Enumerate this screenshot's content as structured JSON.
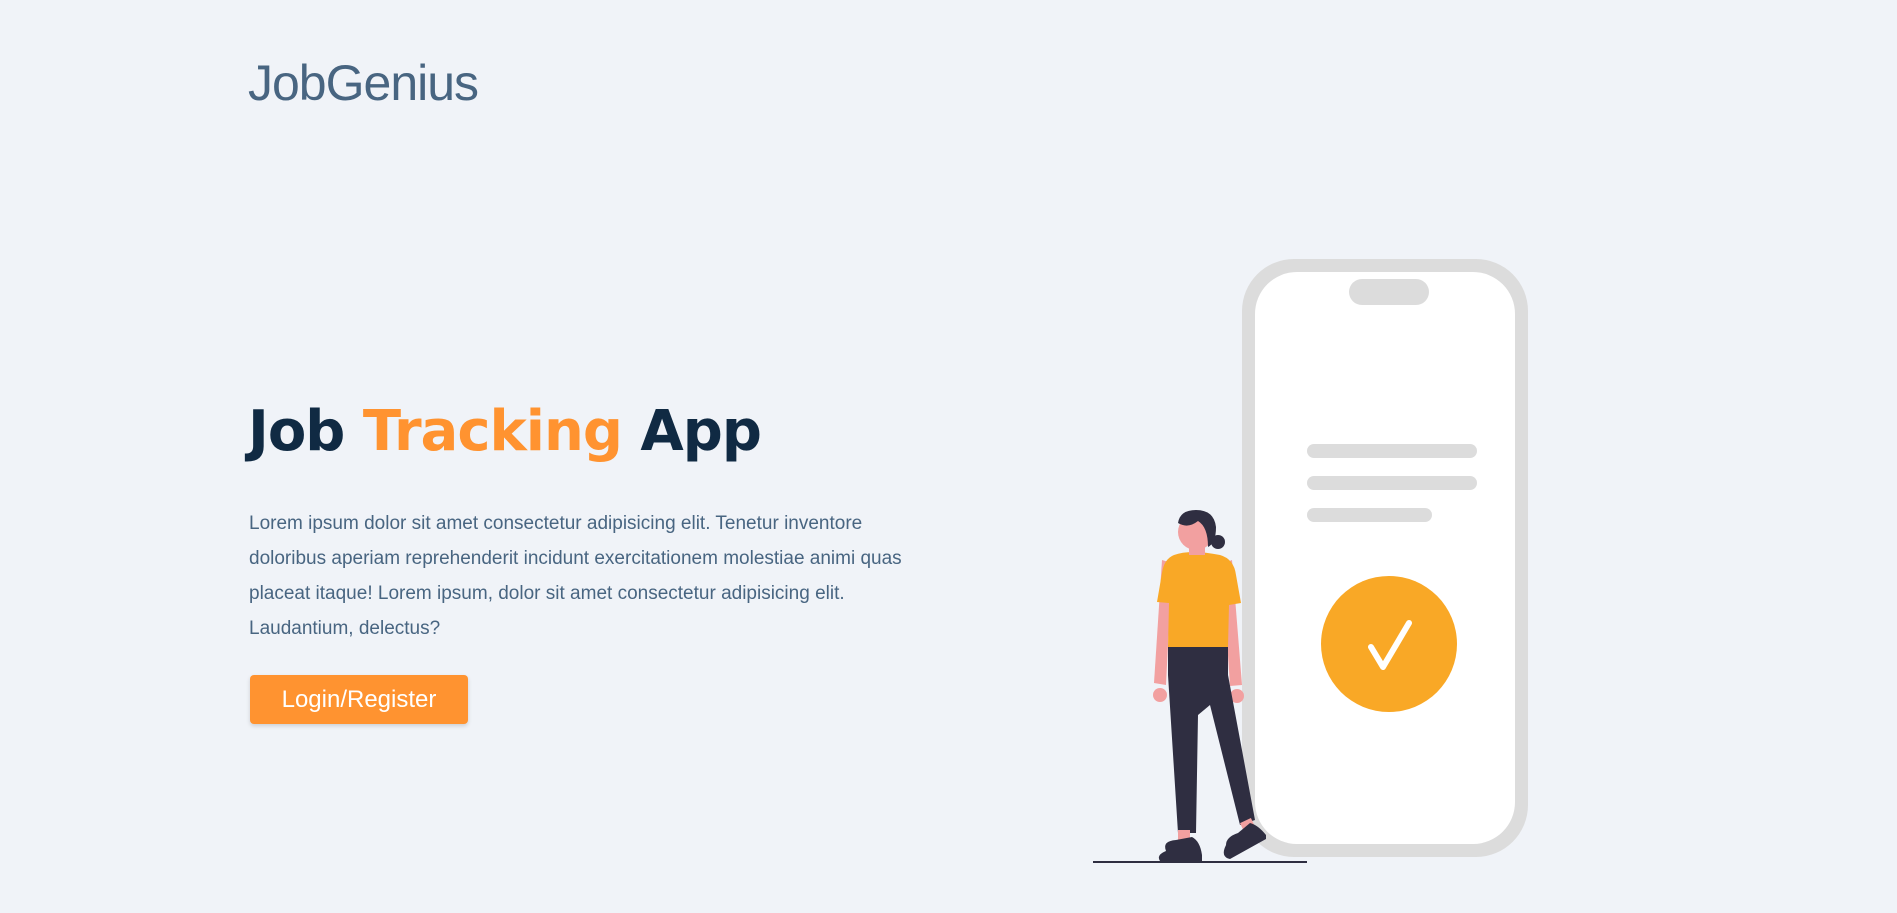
{
  "header": {
    "logo_text": "JobGenius"
  },
  "hero": {
    "title_part1": "Job ",
    "title_accent": "Tracking",
    "title_part2": " App",
    "description": "Lorem ipsum dolor sit amet consectetur adipisicing elit. Tenetur inventore doloribus aperiam reprehenderit incidunt exercitationem molestiae animi quas placeat itaque! Lorem ipsum, dolor sit amet consectetur adipisicing elit. Laudantium, delectus?",
    "cta_label": "Login/Register"
  },
  "colors": {
    "background": "#f0f3f8",
    "logo": "#486581",
    "title": "#102a43",
    "accent": "#ff9330",
    "body_text": "#486581",
    "illustration_accent": "#f9a826",
    "phone_frame": "#dcdcdc"
  },
  "icons": {
    "illustration": "woman-with-phone-checkmark-illustration",
    "check": "checkmark-icon"
  }
}
